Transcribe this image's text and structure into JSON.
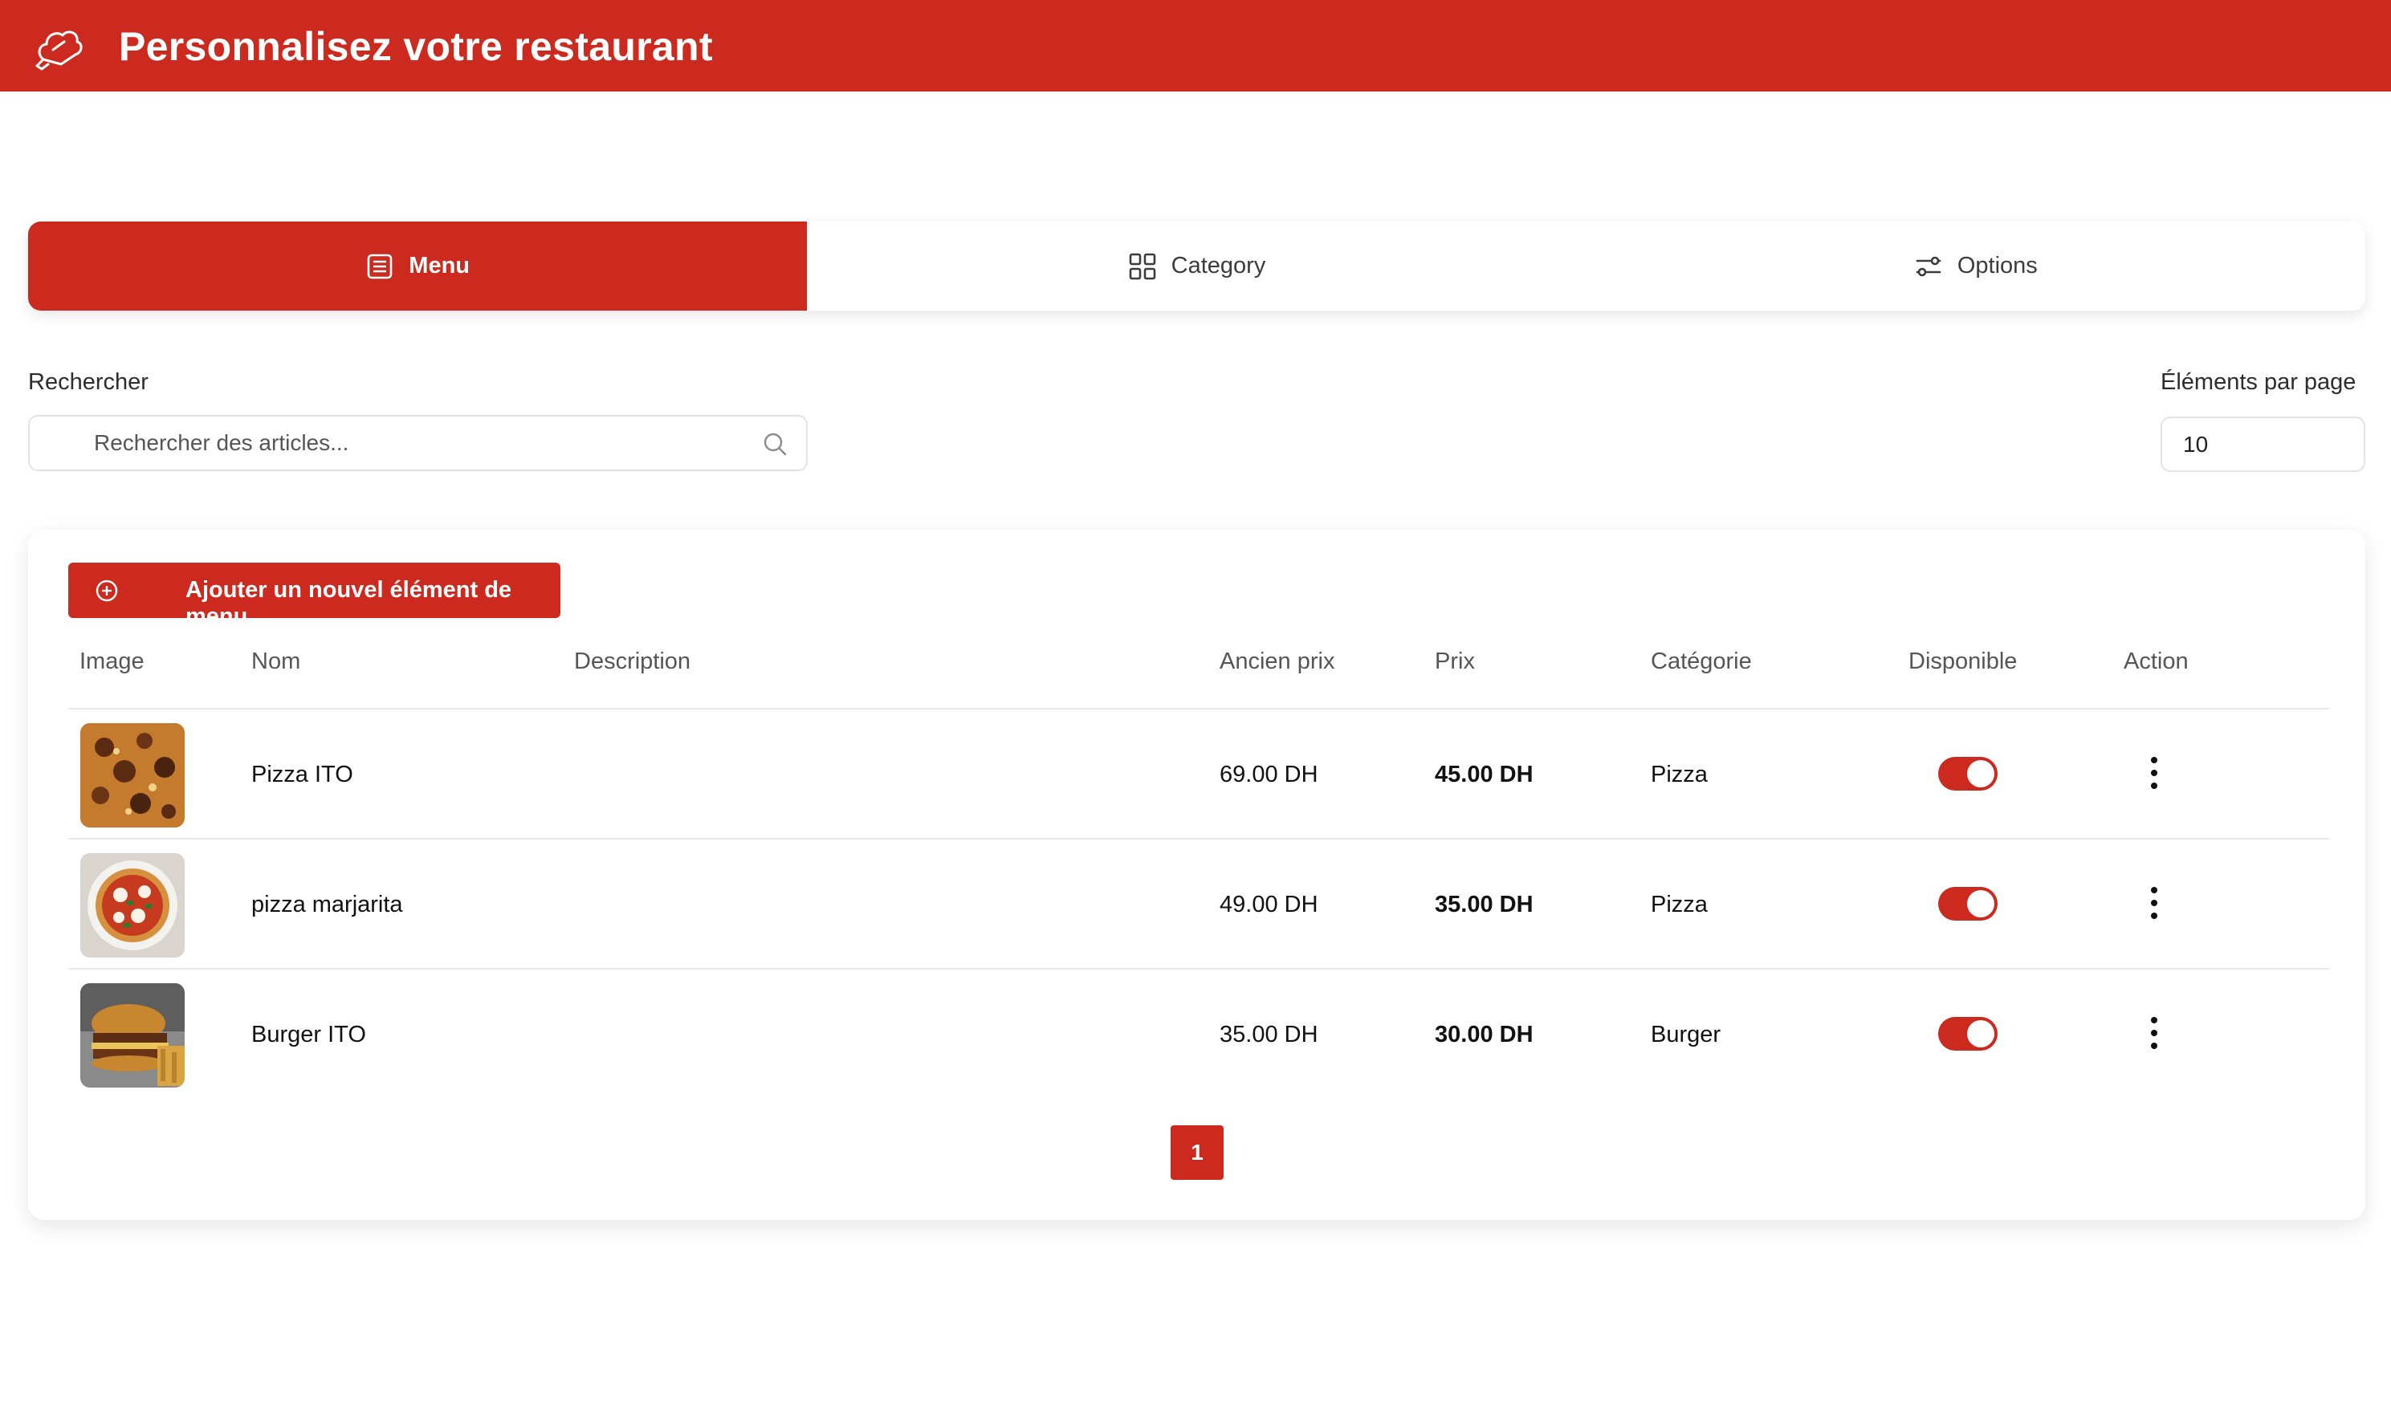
{
  "header": {
    "title": "Personnalisez votre restaurant",
    "logo_icon": "chef-hat-icon"
  },
  "tabs": [
    {
      "label": "Menu",
      "icon": "list-icon",
      "active": true
    },
    {
      "label": "Category",
      "icon": "grid-icon",
      "active": false
    },
    {
      "label": "Options",
      "icon": "sliders-icon",
      "active": false
    }
  ],
  "search": {
    "label": "Rechercher",
    "placeholder": "Rechercher des articles..."
  },
  "per_page": {
    "label": "Éléments par page",
    "value": "10"
  },
  "add_button": {
    "label": "Ajouter un nouvel élément de menu"
  },
  "table": {
    "columns": [
      "Image",
      "Nom",
      "Description",
      "Ancien prix",
      "Prix",
      "Catégorie",
      "Disponible",
      "Action"
    ],
    "rows": [
      {
        "name": "Pizza ITO",
        "description": "",
        "old_price": "69.00 DH",
        "price": "45.00 DH",
        "category": "Pizza",
        "available": true,
        "image": "pizza-ito"
      },
      {
        "name": "pizza marjarita",
        "description": "",
        "old_price": "49.00 DH",
        "price": "35.00 DH",
        "category": "Pizza",
        "available": true,
        "image": "pizza-margherita"
      },
      {
        "name": "Burger ITO",
        "description": "",
        "old_price": "35.00 DH",
        "price": "30.00 DH",
        "category": "Burger",
        "available": true,
        "image": "burger"
      }
    ]
  },
  "pagination": {
    "current": "1"
  },
  "colors": {
    "brand": "#cc291f"
  }
}
